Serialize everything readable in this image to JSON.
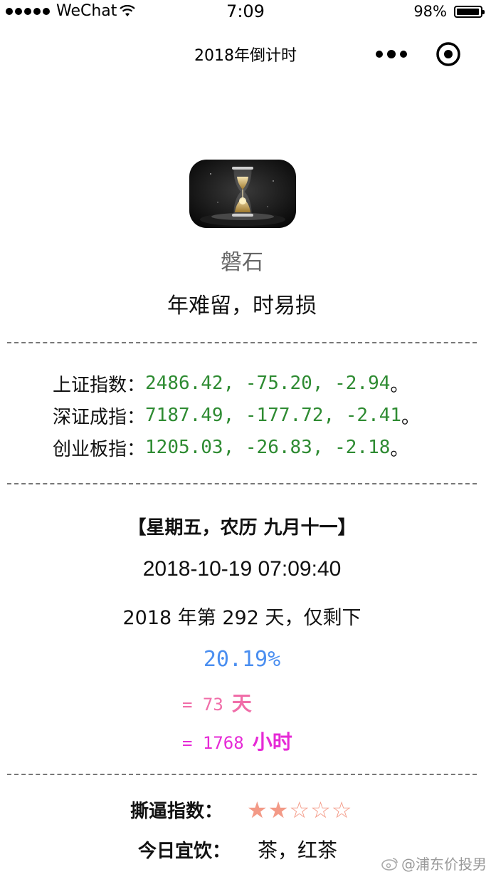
{
  "status_bar": {
    "carrier": "WeChat",
    "time": "7:09",
    "battery_percent": "98%",
    "battery_level": 0.98
  },
  "nav": {
    "title": "2018年倒计时"
  },
  "profile": {
    "name": "磐石",
    "motto": "年难留，时易损"
  },
  "stocks": [
    {
      "label": "上证指数：",
      "values": "2486.42, -75.20, -2.94",
      "end": "。"
    },
    {
      "label": "深证成指：",
      "values": "7187.49, -177.72, -2.41",
      "end": "。"
    },
    {
      "label": "创业板指：",
      "values": "1205.03, -26.83, -2.18",
      "end": "。"
    }
  ],
  "date": {
    "lunar": "【星期五，农历 九月十一】",
    "datetime": "2018-10-19 07:09:40",
    "day_of_year": "2018 年第 292 天，仅剩下",
    "percent_left": "20.19%",
    "days_left": "= 73",
    "days_unit": "天",
    "hours_left": "= 1768",
    "hours_unit": "小时"
  },
  "index": {
    "label": "撕逼指数：",
    "stars_full": "★★",
    "stars_empty": "☆☆☆",
    "rating": 2,
    "rating_max": 5
  },
  "drink": {
    "label": "今日宜饮：",
    "value": "茶，红茶"
  },
  "watermark": "@浦东价投男"
}
